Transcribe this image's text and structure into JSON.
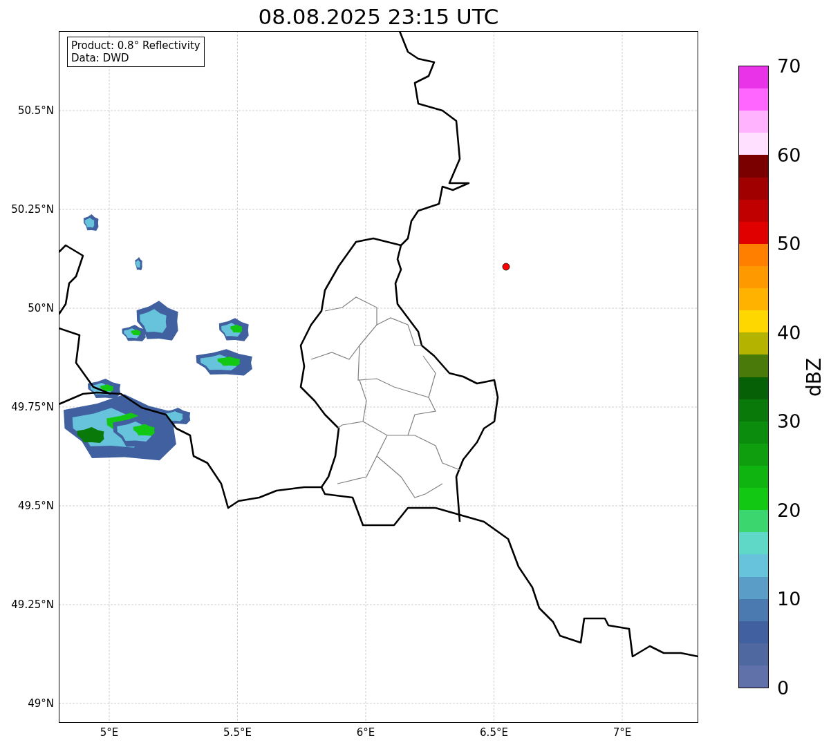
{
  "title": "08.08.2025 23:15 UTC",
  "info_box": [
    "Product: 0.8° Reflectivity",
    "Data: DWD"
  ],
  "lat_ticks": [
    "50.5°N",
    "50.25°N",
    "50°N",
    "49.75°N",
    "49.5°N",
    "49.25°N",
    "49°N"
  ],
  "lon_ticks": [
    "5°E",
    "5.5°E",
    "6°E",
    "6.5°E",
    "7°E"
  ],
  "colorbar": {
    "label": "dBZ",
    "ticks": [
      "70",
      "60",
      "50",
      "40",
      "30",
      "20",
      "10",
      "0"
    ],
    "bands": [
      {
        "color": "#e833e8"
      },
      {
        "color": "#ff66ff"
      },
      {
        "color": "#ffb3ff"
      },
      {
        "color": "#ffe0ff"
      },
      {
        "color": "#7a0000"
      },
      {
        "color": "#a00000"
      },
      {
        "color": "#c00000"
      },
      {
        "color": "#e00000"
      },
      {
        "color": "#ff8000"
      },
      {
        "color": "#ff9900"
      },
      {
        "color": "#ffb300"
      },
      {
        "color": "#ffd700"
      },
      {
        "color": "#b3b300"
      },
      {
        "color": "#4a7a0a"
      },
      {
        "color": "#066006"
      },
      {
        "color": "#097a09"
      },
      {
        "color": "#0c8c0c"
      },
      {
        "color": "#0e9e0e"
      },
      {
        "color": "#10b410"
      },
      {
        "color": "#12c812"
      },
      {
        "color": "#3cd66e"
      },
      {
        "color": "#5fd8c8"
      },
      {
        "color": "#66c3db"
      },
      {
        "color": "#5a9ec8"
      },
      {
        "color": "#4a7ab0"
      },
      {
        "color": "#4060a0"
      },
      {
        "color": "#5068a0"
      },
      {
        "color": "#6070a8"
      }
    ]
  }
}
